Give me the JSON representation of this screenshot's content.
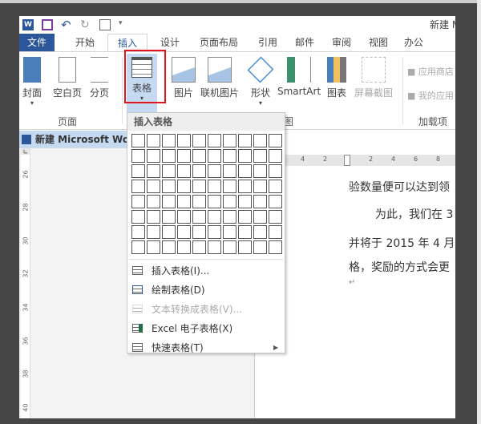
{
  "window": {
    "title": "新建 Microsoft Word"
  },
  "qat": {
    "icons": [
      "word-logo-icon",
      "save-icon",
      "undo-icon",
      "redo-icon",
      "print-preview-icon",
      "customize-icon"
    ]
  },
  "tabs": [
    "文件",
    "开始",
    "插入",
    "设计",
    "页面布局",
    "引用",
    "邮件",
    "审阅",
    "视图",
    "办公"
  ],
  "active_tab": "插入",
  "ribbon": {
    "buttons": [
      "封面",
      "空白页",
      "分页",
      "表格",
      "图片",
      "联机图片",
      "形状",
      "SmartArt",
      "图表",
      "屏幕截图",
      "应用商店",
      "我的应用"
    ],
    "groups": [
      "页面",
      "图",
      "加载项"
    ]
  },
  "doc_tab": "新建 Microsoft Wor",
  "dropdown": {
    "header": "插入表格",
    "grid": {
      "columns": 10,
      "rows": 8
    },
    "items": [
      {
        "label": "插入表格(I)...",
        "enabled": true
      },
      {
        "label": "绘制表格(D)",
        "enabled": true
      },
      {
        "label": "文本转换成表格(V)...",
        "enabled": false
      },
      {
        "label": "Excel 电子表格(X)",
        "enabled": true
      },
      {
        "label": "快速表格(T)",
        "enabled": true,
        "submenu": true
      }
    ]
  },
  "ruler": {
    "h": [
      "4",
      "2",
      "2",
      "4",
      "6",
      "8"
    ],
    "v": [
      "26",
      "28",
      "30",
      "32",
      "34",
      "36",
      "38",
      "40"
    ]
  },
  "document": {
    "lines": [
      "验数量便可以达到领",
      "为此，我们在 3",
      "并将于 2015 年 4 月",
      "格，奖励的方式会更",
      "↵"
    ]
  },
  "colors": {
    "accent": "#2b579a",
    "highlight": "#e0161c"
  }
}
